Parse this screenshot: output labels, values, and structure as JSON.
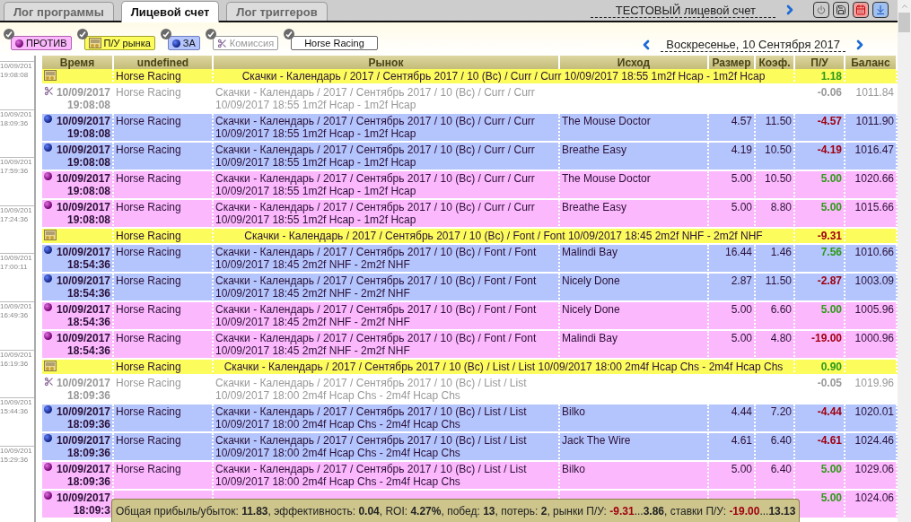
{
  "tabs": [
    {
      "label": "Лог программы",
      "selected": false
    },
    {
      "label": "Лицевой счет",
      "selected": true
    },
    {
      "label": "Лог триггеров",
      "selected": false
    }
  ],
  "account": {
    "title": "ТЕСТОВЫЙ лицевой счет"
  },
  "filters": [
    {
      "kind": "lay",
      "label": "ПРОТИВ",
      "checked": true
    },
    {
      "kind": "market",
      "label": "П/У рынка",
      "checked": true
    },
    {
      "kind": "back",
      "label": "ЗА",
      "checked": true
    },
    {
      "kind": "commission",
      "label": "Комиссия",
      "checked": true
    },
    {
      "kind": "sport",
      "label": "Horse Racing",
      "checked": true
    }
  ],
  "date": "Воскресенье, 10 Сентября 2017",
  "timeline": [
    {
      "date": "10/09/201",
      "time": "19:08:08"
    },
    {
      "date": "10/09/201",
      "time": "18:09:36"
    },
    {
      "date": "10/09/201",
      "time": "17:59:36"
    },
    {
      "date": "10/09/201",
      "time": "17:24:36"
    },
    {
      "date": "10/09/201",
      "time": "17:00:11"
    },
    {
      "date": "10/09/201",
      "time": "16:49:36"
    },
    {
      "date": "10/09/201",
      "time": "16:19:36"
    },
    {
      "date": "10/09/201",
      "time": "15:44:36"
    },
    {
      "date": "10/09/201",
      "time": "15:29:36"
    }
  ],
  "table": {
    "columns": [
      "Время",
      "undefined",
      "Рынок",
      "Исход",
      "Размер",
      "Коэф.",
      "П/У",
      "Баланс"
    ],
    "rows": [
      {
        "kind": "market",
        "sport": "Horse Racing",
        "market": "Скачки - Календарь / 2017 / Сентябрь 2017 / 10 (Вс) / Curr / Curr 10/09/2017 18:55 1m2f Hcap - 1m2f Hcap",
        "pl": "1.18",
        "loss": false
      },
      {
        "kind": "commission",
        "date": "10/09/2017",
        "time": "19:08:08",
        "sport": "Horse Racing",
        "market": "Скачки - Календарь / 2017 / Сентябрь 2017 / 10 (Вс) / Curr / Curr 10/09/2017 18:55 1m2f Hcap - 1m2f Hcap",
        "pl": "-0.06",
        "balance": "1011.84"
      },
      {
        "kind": "back",
        "date": "10/09/2017",
        "time": "19:08:08",
        "sport": "Horse Racing",
        "market": "Скачки - Календарь / 2017 / Сентябрь 2017 / 10 (Вс) / Curr / Curr 10/09/2017 18:55 1m2f Hcap - 1m2f Hcap",
        "runner": "The Mouse Doctor",
        "size": "4.57",
        "odds": "11.50",
        "pl": "-4.57",
        "loss": true,
        "balance": "1011.90"
      },
      {
        "kind": "back",
        "date": "10/09/2017",
        "time": "19:08:08",
        "sport": "Horse Racing",
        "market": "Скачки - Календарь / 2017 / Сентябрь 2017 / 10 (Вс) / Curr / Curr 10/09/2017 18:55 1m2f Hcap - 1m2f Hcap",
        "runner": "Breathe Easy",
        "size": "4.19",
        "odds": "10.50",
        "pl": "-4.19",
        "loss": true,
        "balance": "1016.47"
      },
      {
        "kind": "lay",
        "date": "10/09/2017",
        "time": "19:08:08",
        "sport": "Horse Racing",
        "market": "Скачки - Календарь / 2017 / Сентябрь 2017 / 10 (Вс) / Curr / Curr 10/09/2017 18:55 1m2f Hcap - 1m2f Hcap",
        "runner": "The Mouse Doctor",
        "size": "5.00",
        "odds": "10.50",
        "pl": "5.00",
        "loss": false,
        "balance": "1020.66"
      },
      {
        "kind": "lay",
        "date": "10/09/2017",
        "time": "19:08:08",
        "sport": "Horse Racing",
        "market": "Скачки - Календарь / 2017 / Сентябрь 2017 / 10 (Вс) / Curr / Curr 10/09/2017 18:55 1m2f Hcap - 1m2f Hcap",
        "runner": "Breathe Easy",
        "size": "5.00",
        "odds": "8.80",
        "pl": "5.00",
        "loss": false,
        "balance": "1015.66"
      },
      {
        "kind": "market",
        "sport": "Horse Racing",
        "market": "Скачки - Календарь / 2017 / Сентябрь 2017 / 10 (Вс) / Font / Font 10/09/2017 18:45 2m2f NHF - 2m2f NHF",
        "pl": "-9.31",
        "loss": true
      },
      {
        "kind": "back",
        "date": "10/09/2017",
        "time": "18:54:36",
        "sport": "Horse Racing",
        "market": "Скачки - Календарь / 2017 / Сентябрь 2017 / 10 (Вс) / Font / Font 10/09/2017 18:45 2m2f NHF - 2m2f NHF",
        "runner": "Malindi Bay",
        "size": "16.44",
        "odds": "1.46",
        "pl": "7.56",
        "loss": false,
        "balance": "1010.66"
      },
      {
        "kind": "back",
        "date": "10/09/2017",
        "time": "18:54:36",
        "sport": "Horse Racing",
        "market": "Скачки - Календарь / 2017 / Сентябрь 2017 / 10 (Вс) / Font / Font 10/09/2017 18:45 2m2f NHF - 2m2f NHF",
        "runner": "Nicely Done",
        "size": "2.87",
        "odds": "11.50",
        "pl": "-2.87",
        "loss": true,
        "balance": "1003.09"
      },
      {
        "kind": "lay",
        "date": "10/09/2017",
        "time": "18:54:36",
        "sport": "Horse Racing",
        "market": "Скачки - Календарь / 2017 / Сентябрь 2017 / 10 (Вс) / Font / Font 10/09/2017 18:45 2m2f NHF - 2m2f NHF",
        "runner": "Nicely Done",
        "size": "5.00",
        "odds": "6.60",
        "pl": "5.00",
        "loss": false,
        "balance": "1005.96"
      },
      {
        "kind": "lay",
        "date": "10/09/2017",
        "time": "18:54:36",
        "sport": "Horse Racing",
        "market": "Скачки - Календарь / 2017 / Сентябрь 2017 / 10 (Вс) / Font / Font 10/09/2017 18:45 2m2f NHF - 2m2f NHF",
        "runner": "Malindi Bay",
        "size": "5.00",
        "odds": "4.80",
        "pl": "-19.00",
        "loss": true,
        "balance": "1000.96"
      },
      {
        "kind": "market",
        "sport": "Horse Racing",
        "market": "Скачки - Календарь / 2017 / Сентябрь 2017 / 10 (Вс) / List / List 10/09/2017 18:00 2m4f Hcap Chs - 2m4f Hcap Chs",
        "pl": "0.90",
        "loss": false
      },
      {
        "kind": "commission",
        "date": "10/09/2017",
        "time": "18:09:36",
        "sport": "Horse Racing",
        "market": "Скачки - Календарь / 2017 / Сентябрь 2017 / 10 (Вс) / List / List 10/09/2017 18:00 2m4f Hcap Chs - 2m4f Hcap Chs",
        "pl": "-0.05",
        "balance": "1019.96"
      },
      {
        "kind": "back",
        "date": "10/09/2017",
        "time": "18:09:36",
        "sport": "Horse Racing",
        "market": "Скачки - Календарь / 2017 / Сентябрь 2017 / 10 (Вс) / List / List 10/09/2017 18:00 2m4f Hcap Chs - 2m4f Hcap Chs",
        "runner": "Bilko",
        "size": "4.44",
        "odds": "7.20",
        "pl": "-4.44",
        "loss": true,
        "balance": "1020.01"
      },
      {
        "kind": "back",
        "date": "10/09/2017",
        "time": "18:09:36",
        "sport": "Horse Racing",
        "market": "Скачки - Календарь / 2017 / Сентябрь 2017 / 10 (Вс) / List / List 10/09/2017 18:00 2m4f Hcap Chs - 2m4f Hcap Chs",
        "runner": "Jack The Wire",
        "size": "4.61",
        "odds": "6.40",
        "pl": "-4.61",
        "loss": true,
        "balance": "1024.46"
      },
      {
        "kind": "lay",
        "date": "10/09/2017",
        "time": "18:09:36",
        "sport": "Horse Racing",
        "market": "Скачки - Календарь / 2017 / Сентябрь 2017 / 10 (Вс) / List / List 10/09/2017 18:00 2m4f Hcap Chs - 2m4f Hcap Chs",
        "runner": "Bilko",
        "size": "5.00",
        "odds": "6.40",
        "pl": "5.00",
        "loss": false,
        "balance": "1029.06"
      },
      {
        "kind": "lay",
        "date": "10/09/2017",
        "time": "18:09:3",
        "pl": "5.00",
        "loss": false,
        "balance": "1024.06"
      }
    ]
  },
  "summary": [
    {
      "kind": "plain",
      "text": "Общая прибыль/убыток: "
    },
    {
      "kind": "bold",
      "text": "11.83"
    },
    {
      "kind": "plain",
      "text": ", эффективность: "
    },
    {
      "kind": "bold",
      "text": "0.04"
    },
    {
      "kind": "plain",
      "text": ", ROI: "
    },
    {
      "kind": "bold",
      "text": "4.27%"
    },
    {
      "kind": "plain",
      "text": ", побед: "
    },
    {
      "kind": "bold",
      "text": "13"
    },
    {
      "kind": "plain",
      "text": ", потерь: "
    },
    {
      "kind": "bold",
      "text": "2"
    },
    {
      "kind": "plain",
      "text": ", рынки П/У: "
    },
    {
      "kind": "loss",
      "text": "-9.31"
    },
    {
      "kind": "plain",
      "text": "..."
    },
    {
      "kind": "bold",
      "text": "3.86"
    },
    {
      "kind": "plain",
      "text": ", ставки П/У: "
    },
    {
      "kind": "loss",
      "text": "-19.00"
    },
    {
      "kind": "plain",
      "text": "..."
    },
    {
      "kind": "bold",
      "text": "13.13"
    }
  ]
}
